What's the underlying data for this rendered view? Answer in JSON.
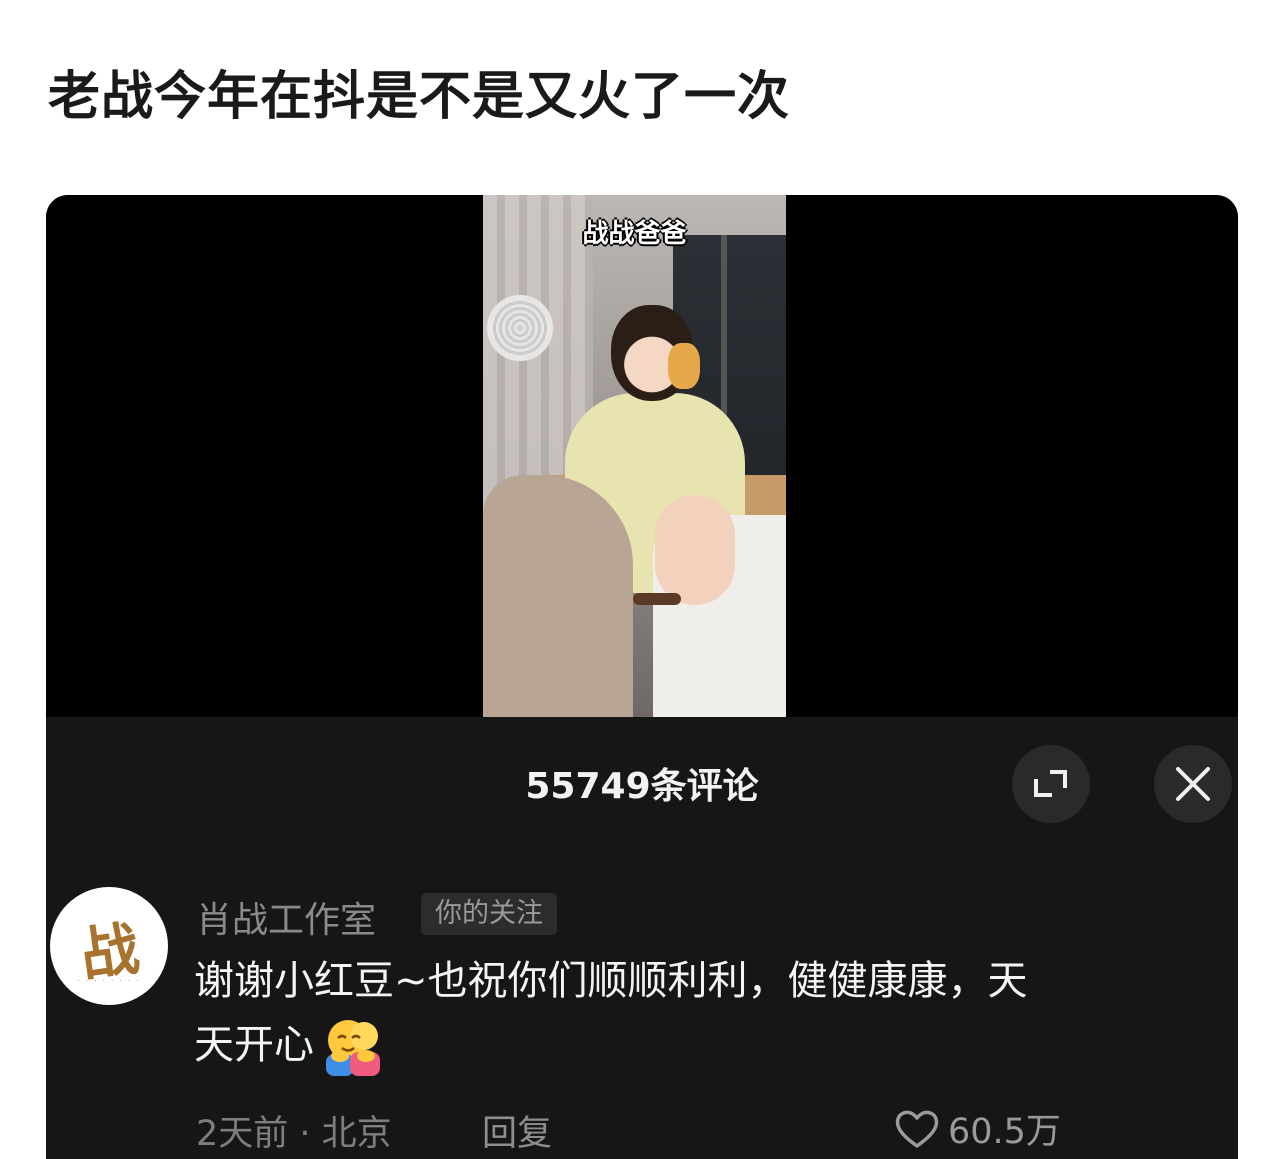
{
  "post": {
    "title": "老战今年在抖是不是又火了一次"
  },
  "video": {
    "caption": "战战爸爸"
  },
  "comments": {
    "count_label": "55749条评论",
    "items": [
      {
        "avatar_glyph": "战",
        "username": "肖战工作室",
        "badge": "你的关注",
        "text_line1": "谢谢小红豆~也祝你们顺顺利利，健健康康，天",
        "text_line2": "天开心",
        "emoji": "hugging-emoji",
        "time_location": "2天前 · 北京",
        "reply_label": "回复",
        "like_count": "60.5万"
      }
    ]
  },
  "icons": {
    "expand": "expand-icon",
    "close": "close-icon",
    "like": "heart-icon"
  },
  "colors": {
    "panel_bg": "#161616",
    "text_primary": "#f4f4f4",
    "text_secondary": "#8a8a8a",
    "avatar_gold": "#a8722f"
  }
}
